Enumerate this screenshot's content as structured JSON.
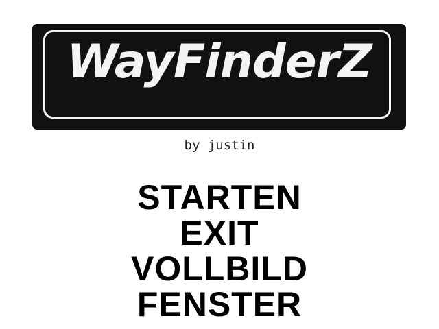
{
  "title": {
    "logo_text": "WayFinderZ",
    "subtitle": "by justin"
  },
  "menu": {
    "items": [
      {
        "label": "STARTEN"
      },
      {
        "label": "EXIT"
      },
      {
        "label": "VOLLBILD"
      },
      {
        "label": "FENSTER"
      }
    ]
  },
  "colors": {
    "background": "#ffffff",
    "logo_background": "#111111",
    "logo_foreground": "#f4f4f4",
    "text": "#000000"
  }
}
